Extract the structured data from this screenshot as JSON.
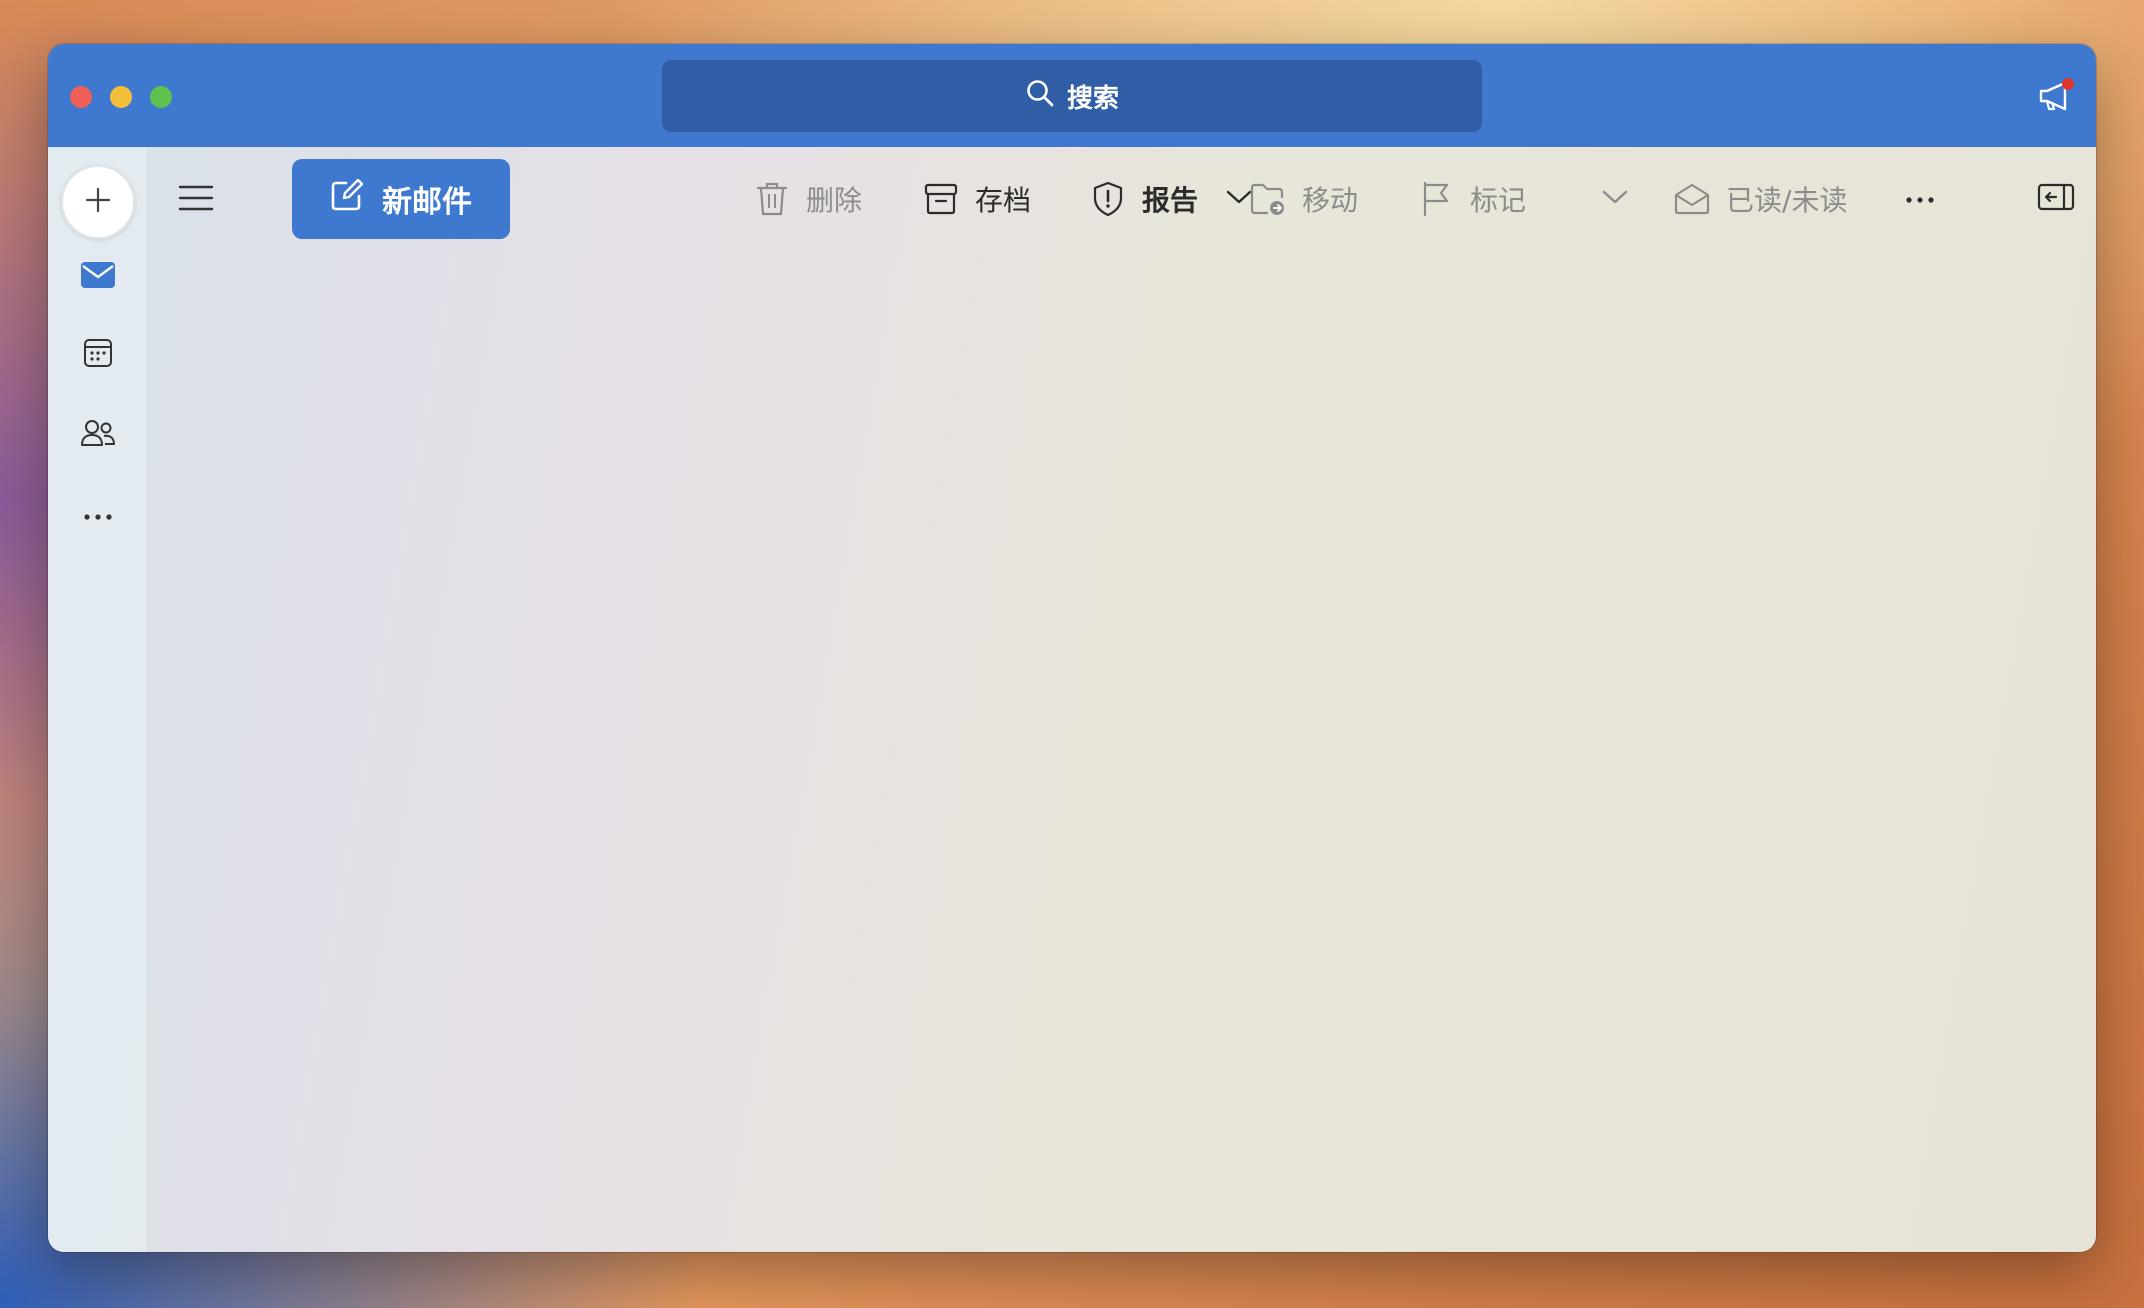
{
  "window": {
    "search": {
      "label": "搜索"
    }
  },
  "toolbar": {
    "new_mail_label": "新邮件",
    "delete_label": "删除",
    "archive_label": "存档",
    "report_label": "报告",
    "move_label": "移动",
    "flag_label": "标记",
    "read_unread_label": "已读/未读"
  },
  "rail": {
    "items": [
      {
        "icon": "mail-icon",
        "active": true
      },
      {
        "icon": "calendar-icon",
        "active": false
      },
      {
        "icon": "people-icon",
        "active": false
      },
      {
        "icon": "more-icon",
        "active": false
      }
    ]
  },
  "colors": {
    "accent": "#3f78cf",
    "search_bg": "#2f5ea6",
    "close": "#ed5f57",
    "minimize": "#f4bd3a",
    "maximize": "#5ec24f",
    "notification_dot": "#e0362c"
  }
}
